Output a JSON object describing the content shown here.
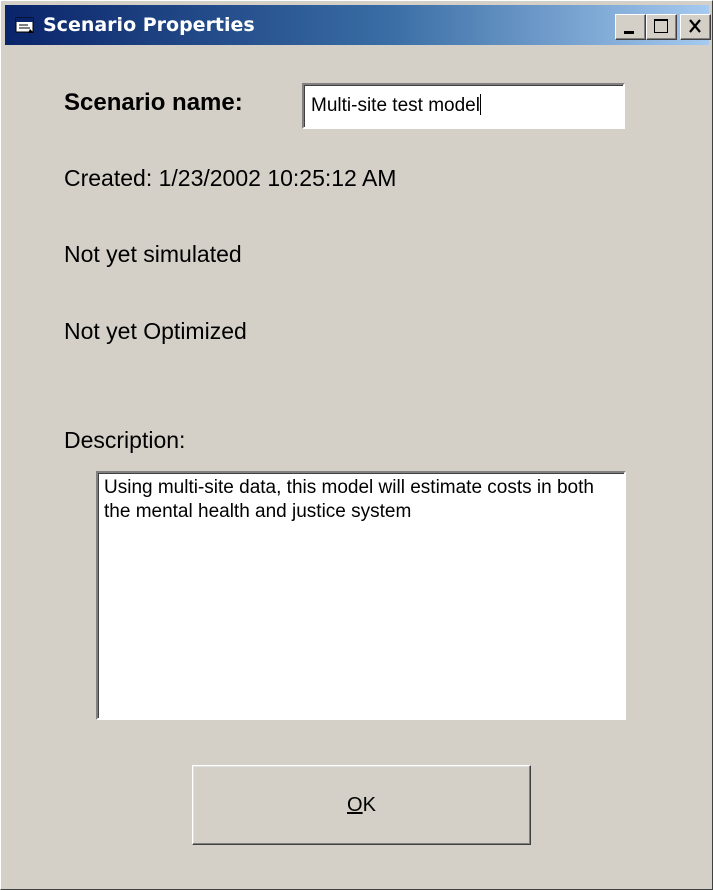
{
  "window": {
    "title": "Scenario Properties",
    "title_icon": "scenario-app-icon",
    "controls": {
      "minimize_icon": "minimize-icon",
      "maximize_icon": "maximize-icon",
      "close_icon": "close-icon"
    }
  },
  "form": {
    "name_label": "Scenario name:",
    "name_value": "Multi-site test model",
    "created_text": "Created: 1/23/2002 10:25:12 AM",
    "simulated_status": "Not yet simulated",
    "optimized_status": "Not yet Optimized",
    "description_label": "Description:",
    "description_value": "Using multi-site data, this model will estimate costs in both the mental health and justice system"
  },
  "buttons": {
    "ok_mnemonic": "O",
    "ok_rest": "K"
  },
  "colors": {
    "title_bar_start": "#0a246a",
    "title_bar_end": "#a6caf0",
    "face": "#d4d0c8"
  }
}
